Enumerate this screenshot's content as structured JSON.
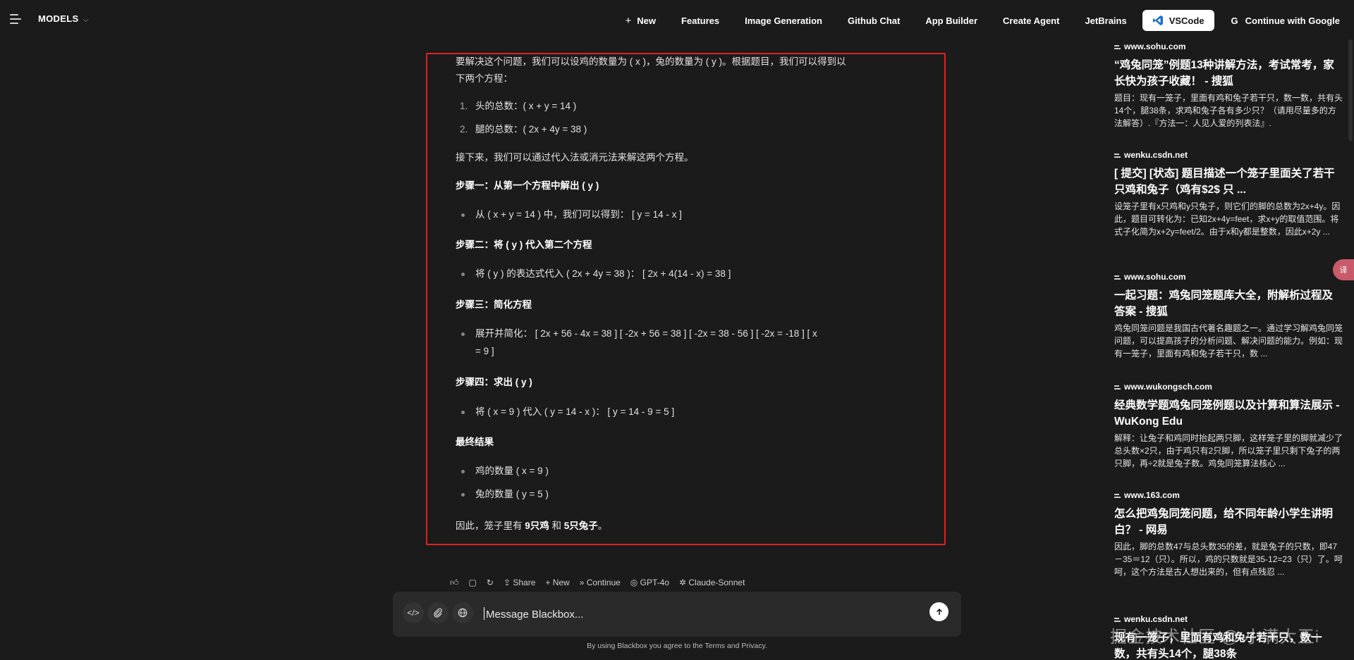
{
  "topbar": {
    "models_label": "MODELS",
    "nav": [
      "New",
      "Features",
      "Image Generation",
      "Github Chat",
      "App Builder",
      "Create Agent",
      "JetBrains"
    ],
    "vscode_label": "VSCode",
    "google_label": "Continue with Google"
  },
  "answer": {
    "intro1": "要解决这个问题，我们可以设鸡的数量为 ( x )，兔的数量为 ( y )。根据题目，我们可以得到以",
    "intro2": "下两个方程：",
    "eq1": "头的总数：( x + y = 14 )",
    "eq2": "腿的总数：( 2x + 4y = 38 )",
    "next": "接下来，我们可以通过代入法或消元法来解这两个方程。",
    "step1": "步骤一：从第一个方程中解出 ( y )",
    "step1_li": "从 ( x + y = 14 ) 中，我们可以得到： [ y = 14 - x ]",
    "step2": "步骤二：将 ( y ) 代入第二个方程",
    "step2_li": "将 ( y ) 的表达式代入 ( 2x + 4y = 38 )： [ 2x + 4(14 - x) = 38 ]",
    "step3": "步骤三：简化方程",
    "step3_li1": "展开并简化： [ 2x + 56 - 4x = 38 ] [ -2x + 56 = 38 ] [ -2x = 38 - 56 ] [ -2x = -18 ] [ x",
    "step3_li2": "= 9 ]",
    "step4": "步骤四：求出 ( y )",
    "step4_li": "将 ( x = 9 ) 代入 ( y = 14 - x )： [ y = 14 - 9 = 5 ]",
    "final_head": "最终结果",
    "res1": "鸡的数量 ( x = 9 )",
    "res2": "兔的数量 ( y = 5 )",
    "conclusion_pre": "因此，笼子里有 ",
    "chickens": "9只鸡",
    "conclusion_mid": " 和 ",
    "rabbits": "5只兔子",
    "conclusion_end": "。"
  },
  "actions": [
    "Share",
    "New",
    "Continue",
    "GPT-4o",
    "Claude-Sonnet"
  ],
  "input": {
    "placeholder": "Message Blackbox...",
    "terms": "By using Blackbox you agree to the Terms and Privacy."
  },
  "sources": [
    {
      "domain": "www.sohu.com",
      "title": "“鸡兔同笼”例题13种讲解方法，考试常考，家长快为孩子收藏！ - 搜狐",
      "snippet": "题目：现有一笼子，里面有鸡和兔子若干只，数一数，共有头14个，腿38条，求鸡和兔子各有多少只？（请用尽量多的方法解答）.『方法一：人见人爱的列表法』."
    },
    {
      "domain": "wenku.csdn.net",
      "title": "[ 提交] [状态] 题目描述一个笼子里面关了若干只鸡和兔子（鸡有$2$ 只 ...",
      "snippet": "设笼子里有x只鸡和y只兔子，则它们的脚的总数为2x+4y。因此，题目可转化为：已知2x+4y=feet，求x+y的取值范围。将式子化简为x+2y=feet/2。由于x和y都是整数，因此x+2y ..."
    },
    {
      "domain": "www.sohu.com",
      "title": "一起习题：鸡兔同笼题库大全，附解析过程及答案 - 搜狐",
      "snippet": "鸡兔同笼问题是我国古代著名趣题之一。通过学习解鸡兔同笼问题，可以提高孩子的分析问题、解决问题的能力。例如：现有一笼子，里面有鸡和兔子若干只，数 ..."
    },
    {
      "domain": "www.wukongsch.com",
      "title": "经典数学题鸡兔同笼例题以及计算和算法展示 - WuKong Edu",
      "snippet": "解释：让兔子和鸡同时抬起两只脚，这样笼子里的脚就减少了总头数×2只，由于鸡只有2只脚，所以笼子里只剩下兔子的两只脚，再÷2就是兔子数。鸡兔同笼算法核心 ..."
    },
    {
      "domain": "www.163.com",
      "title": "怎么把鸡兔同笼问题，给不同年龄小学生讲明白？ - 网易",
      "snippet": "因此，脚的总数47与总头数35的差，就是兔子的只数，即47－35＝12（只）。所以，鸡的只数就是35-12=23（只）了。呵呵，这个方法是古人想出来的，但有点残忍 ..."
    },
    {
      "domain": "wenku.csdn.net",
      "title": "现有一笼子，里面有鸡和兔子若干只，数一数，共有头14个，腿38条",
      "snippet": ""
    }
  ],
  "watermark": "掘金技术社区 @ 小满大王i",
  "side_badge": "译"
}
